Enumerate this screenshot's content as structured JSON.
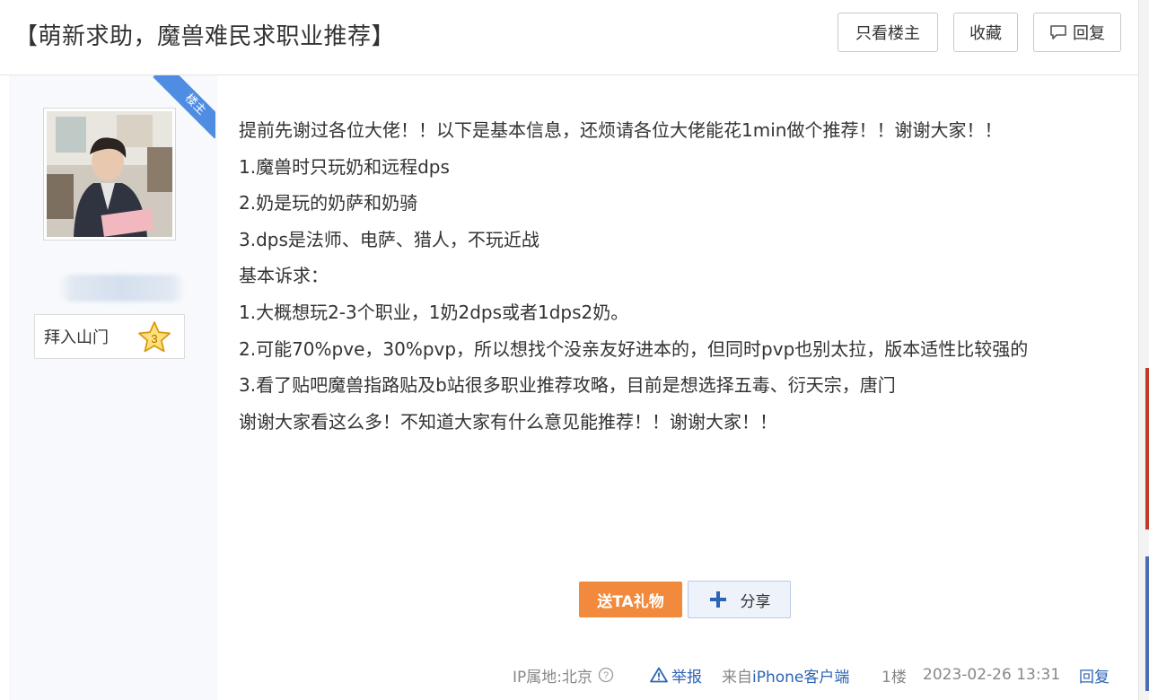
{
  "thread": {
    "title": "【萌新求助，魔兽难民求职业推荐】"
  },
  "toolbar": {
    "only_op_label": "只看楼主",
    "favorite_label": "收藏",
    "reply_label": "回复"
  },
  "author": {
    "op_badge": "楼主",
    "follow_label": "拜入山门",
    "level": "3"
  },
  "post": {
    "lines": [
      "提前先谢过各位大佬！！以下是基本信息，还烦请各位大佬能花1min做个推荐！！谢谢大家！！",
      "1.魔兽时只玩奶和远程dps",
      "2.奶是玩的奶萨和奶骑",
      "3.dps是法师、电萨、猎人，不玩近战",
      "基本诉求：",
      "1.大概想玩2-3个职业，1奶2dps或者1dps2奶。",
      "2.可能70%pve，30%pvp，所以想找个没亲友好进本的，但同时pvp也别太拉，版本适性比较强的",
      "3.看了贴吧魔兽指路贴及b站很多职业推荐攻略，目前是想选择五毒、衍天宗，唐门",
      "谢谢大家看这么多！不知道大家有什么意见能推荐！！谢谢大家！！"
    ]
  },
  "actions": {
    "gift_label": "送TA礼物",
    "share_label": "分享"
  },
  "footer": {
    "ip_label": "IP属地:北京",
    "report_label": "举报",
    "source_prefix": "来自",
    "source_device": "iPhone客户端",
    "floor": "1楼",
    "timestamp": "2023-02-26 13:31",
    "reply_label": "回复"
  },
  "colors": {
    "accent_blue": "#2d64b3",
    "gift_orange": "#f18a3c",
    "op_ribbon": "#4f8de3"
  }
}
